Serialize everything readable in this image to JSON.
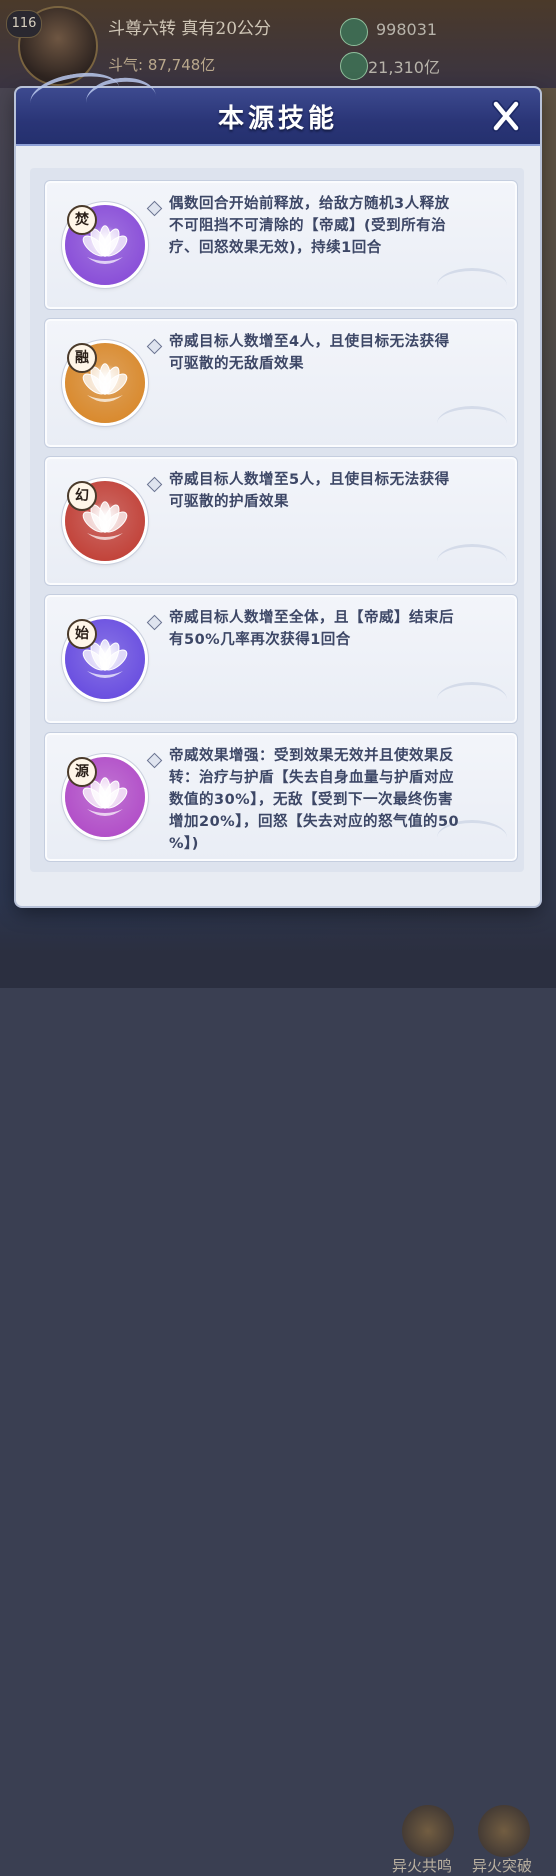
{
  "background": {
    "player": {
      "level": "116",
      "name": "斗尊六转  真有20公分",
      "sub_label": "斗气: 87,748亿",
      "resource_1": "998031",
      "resource_2": "21,310亿"
    },
    "bottom_buttons": [
      "异火共鸣",
      "异火突破"
    ]
  },
  "panel": {
    "title": "本源技能",
    "close_icon": "close-icon",
    "skills": [
      {
        "glyph": "焚",
        "color": "#8a4fd8",
        "lines": [
          "偶数回合开始前释放，给敌方随机3人释放",
          "不可阻挡不可清除的【帝威】(受到所有治",
          "疗、回怒效果无效)，持续1回合"
        ]
      },
      {
        "glyph": "融",
        "color": "#d98a2e",
        "lines": [
          "帝威目标人数增至4人，且使目标无法获得",
          "可驱散的无敌盾效果"
        ]
      },
      {
        "glyph": "幻",
        "color": "#c2433a",
        "lines": [
          "帝威目标人数增至5人，且使目标无法获得",
          "可驱散的护盾效果"
        ]
      },
      {
        "glyph": "始",
        "color": "#6a4fe0",
        "lines": [
          "帝威目标人数增至全体，且【帝威】结束后",
          "有50%几率再次获得1回合"
        ]
      },
      {
        "glyph": "源",
        "color": "#b24fc8",
        "lines": [
          "帝威效果增强：受到效果无效并且使效果反",
          "转：治疗与护盾【失去自身血量与护盾对应",
          "数值的30%】，无敌【受到下一次最终伤害",
          "增加20%】，回怒【失去对应的怒气值的50",
          "%】)"
        ]
      }
    ]
  }
}
